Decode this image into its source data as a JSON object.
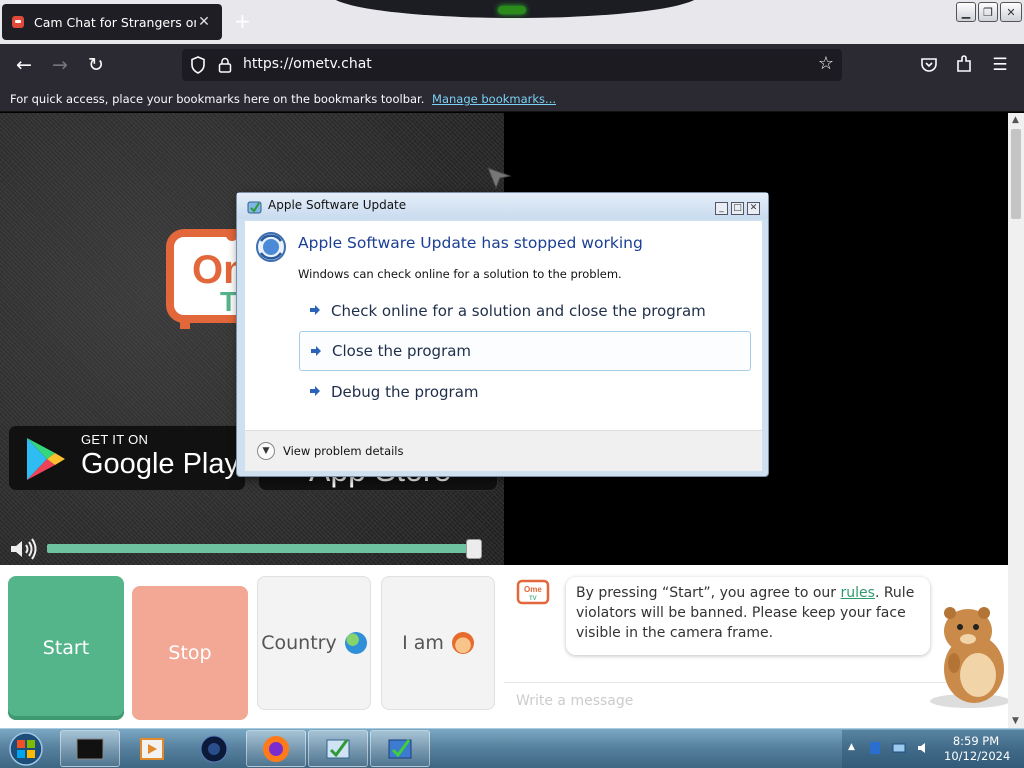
{
  "browser": {
    "tab_title": "Cam Chat for Strangers on Ome",
    "tab_close": "✕",
    "new_tab": "+",
    "url": "https://ometv.chat",
    "bookmark_hint": "For quick access, place your bookmarks here on the bookmarks toolbar.",
    "manage_bookmarks": "Manage bookmarks..."
  },
  "page": {
    "logo_text_top": "Om",
    "logo_text_bottom": "T",
    "google_play_sub": "GET IT ON",
    "google_play_main": "Google Play",
    "app_store_main": "App Store",
    "volume_level": 0.98,
    "buttons": {
      "start": "Start",
      "stop": "Stop",
      "country": "Country",
      "iam": "I am"
    },
    "chat": {
      "mini_logo": "Ome TV",
      "msg_before": "By pressing “Start”, you agree to our ",
      "msg_link": "rules",
      "msg_after": ". Rule violators will be banned. Please keep your face visible in the camera frame.",
      "placeholder": "Write a message"
    }
  },
  "dialog": {
    "title": "Apple Software Update",
    "heading": "Apple Software Update has stopped working",
    "subtext": "Windows can check online for a solution to the problem.",
    "options": [
      "Check online for a solution and close the program",
      "Close the program",
      "Debug the program"
    ],
    "details": "View problem details"
  },
  "taskbar": {
    "time": "8:59 PM",
    "date": "10/12/2024"
  },
  "colors": {
    "start_green": "#54b58a",
    "stop_salmon": "#f2a895",
    "volume_track": "#6fc2a0",
    "dialog_heading": "#1b3f95",
    "link_blue": "#7ad0f5"
  }
}
